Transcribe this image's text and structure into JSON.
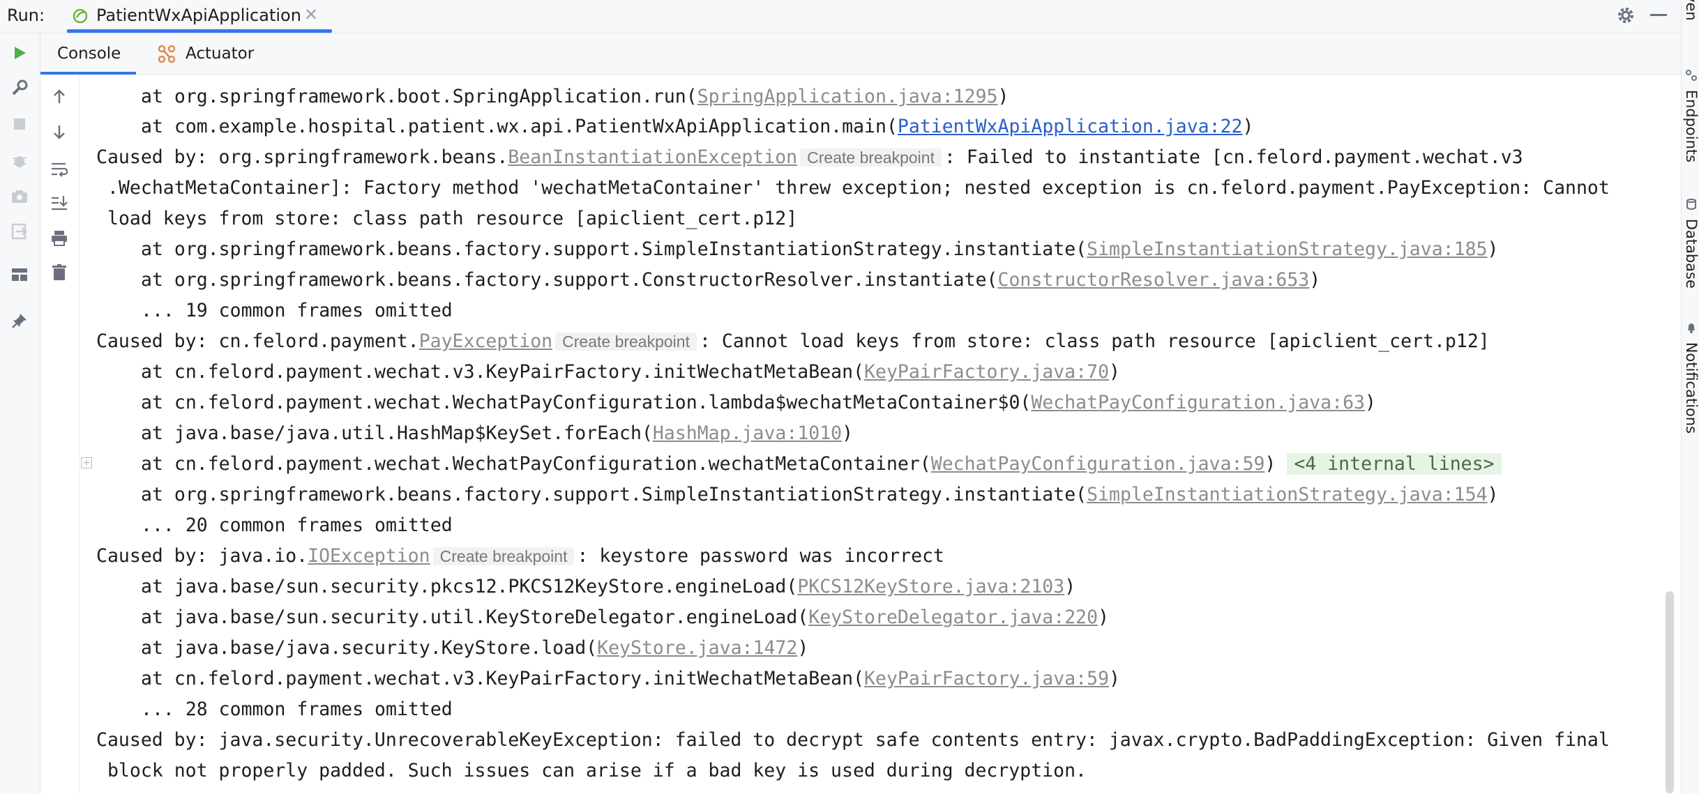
{
  "run_bar": {
    "label": "Run:",
    "tab_title": "PatientWxApiApplication",
    "tab_close": "✕"
  },
  "tabs": {
    "console": "Console",
    "actuator": "Actuator"
  },
  "right_sidebar": {
    "maven": "Maven",
    "endpoints": "Endpoints",
    "database": "Database",
    "notifications": "Notifications"
  },
  "fold_marker": "+",
  "colors": {
    "accent": "#3574f0",
    "run_green": "#4daf4e",
    "link_gray": "#8c8c8c",
    "link_blue": "#2a5fc9",
    "internal_bg": "#e6f4e6"
  },
  "console": {
    "l0": {
      "prefix": "at org.springframework.boot.SpringApplication.run(",
      "link": "SpringApplication.java:1295",
      "suffix": ")"
    },
    "l1": {
      "prefix": "at com.example.hospital.patient.wx.api.PatientWxApiApplication.main(",
      "link": "PatientWxApiApplication.java:22",
      "suffix": ")"
    },
    "l2": {
      "prefix": "Caused by: org.springframework.beans.",
      "link": "BeanInstantiationException",
      "breakpoint": "Create breakpoint",
      "suffix": ": Failed to instantiate [cn.felord.payment.wechat.v3"
    },
    "l3": ".WechatMetaContainer]: Factory method 'wechatMetaContainer' threw exception; nested exception is cn.felord.payment.PayException: Cannot",
    "l4": "load keys from store: class path resource [apiclient_cert.p12]",
    "l5": {
      "prefix": "at org.springframework.beans.factory.support.SimpleInstantiationStrategy.instantiate(",
      "link": "SimpleInstantiationStrategy.java:185",
      "suffix": ")"
    },
    "l6": {
      "prefix": "at org.springframework.beans.factory.support.ConstructorResolver.instantiate(",
      "link": "ConstructorResolver.java:653",
      "suffix": ")"
    },
    "l7": "... 19 common frames omitted",
    "l8": {
      "prefix": "Caused by: cn.felord.payment.",
      "link": "PayException",
      "breakpoint": "Create breakpoint",
      "suffix": ": Cannot load keys from store: class path resource [apiclient_cert.p12]"
    },
    "l9": {
      "prefix": "at cn.felord.payment.wechat.v3.KeyPairFactory.initWechatMetaBean(",
      "link": "KeyPairFactory.java:70",
      "suffix": ")"
    },
    "l10": {
      "prefix": "at cn.felord.payment.wechat.WechatPayConfiguration.lambda$wechatMetaContainer$0(",
      "link": "WechatPayConfiguration.java:63",
      "suffix": ")"
    },
    "l11": {
      "prefix": "at java.base/java.util.HashMap$KeySet.forEach(",
      "link": "HashMap.java:1010",
      "suffix": ")"
    },
    "l12": {
      "prefix": "at cn.felord.payment.wechat.WechatPayConfiguration.wechatMetaContainer(",
      "link": "WechatPayConfiguration.java:59",
      "suffix": ")",
      "internal": "<4 internal lines>"
    },
    "l13": {
      "prefix": "at org.springframework.beans.factory.support.SimpleInstantiationStrategy.instantiate(",
      "link": "SimpleInstantiationStrategy.java:154",
      "suffix": ")"
    },
    "l14": "... 20 common frames omitted",
    "l15": {
      "prefix": "Caused by: java.io.",
      "link": "IOException",
      "breakpoint": "Create breakpoint",
      "suffix": ": keystore password was incorrect"
    },
    "l16": {
      "prefix": "at java.base/sun.security.pkcs12.PKCS12KeyStore.engineLoad(",
      "link": "PKCS12KeyStore.java:2103",
      "suffix": ")"
    },
    "l17": {
      "prefix": "at java.base/sun.security.util.KeyStoreDelegator.engineLoad(",
      "link": "KeyStoreDelegator.java:220",
      "suffix": ")"
    },
    "l18": {
      "prefix": "at java.base/java.security.KeyStore.load(",
      "link": "KeyStore.java:1472",
      "suffix": ")"
    },
    "l19": {
      "prefix": "at cn.felord.payment.wechat.v3.KeyPairFactory.initWechatMetaBean(",
      "link": "KeyPairFactory.java:59",
      "suffix": ")"
    },
    "l20": "... 28 common frames omitted",
    "l21": "Caused by: java.security.UnrecoverableKeyException: failed to decrypt safe contents entry: javax.crypto.BadPaddingException: Given final",
    "l22": "block not properly padded. Such issues can arise if a bad key is used during decryption."
  }
}
